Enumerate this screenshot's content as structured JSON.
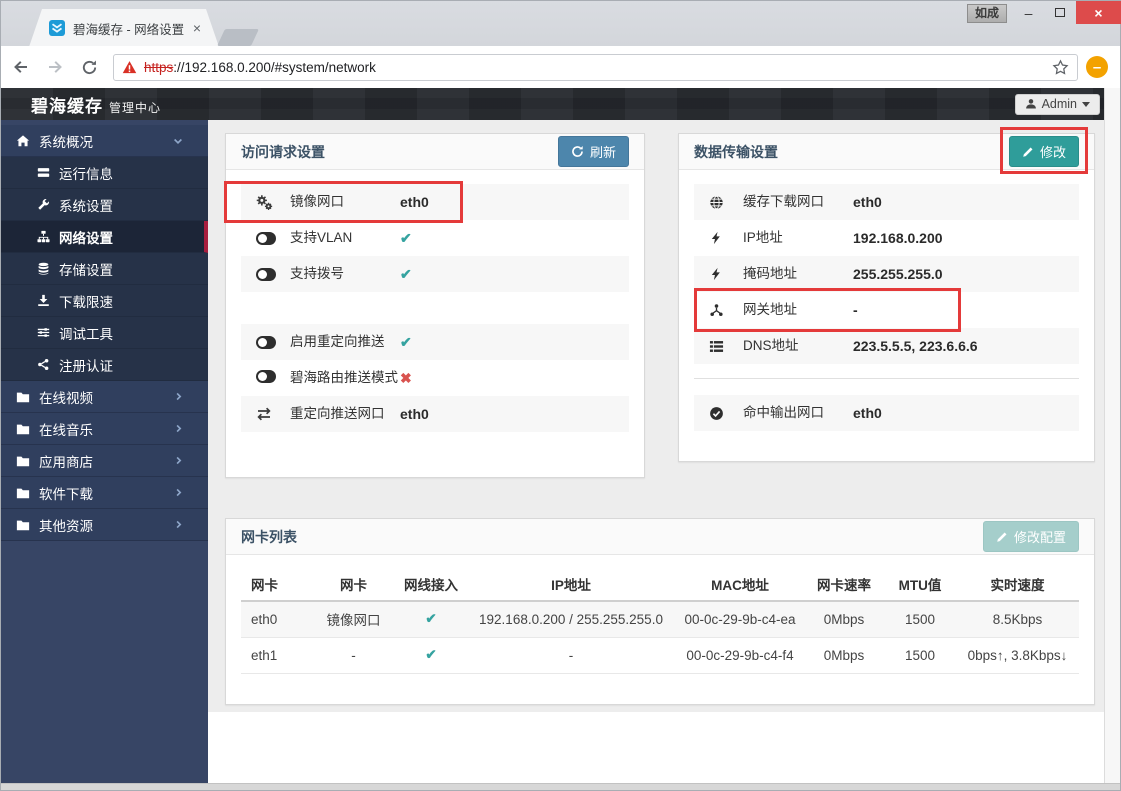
{
  "browser": {
    "tab_title": "碧海缓存 - 网络设置",
    "tab_close": "×",
    "ime_badge": "如成",
    "minimize": "–",
    "close": "×",
    "url_scheme": "https",
    "url_rest": "://192.168.0.200/#system/network",
    "extension_glyph": "–"
  },
  "appbar": {
    "brand": "碧海缓存",
    "brand_sub": "管理中心",
    "user": "Admin"
  },
  "sidebar": {
    "root": "系统概况",
    "submenu": [
      "运行信息",
      "系统设置",
      "网络设置",
      "存储设置",
      "下载限速",
      "调试工具",
      "注册认证"
    ],
    "sections": [
      "在线视频",
      "在线音乐",
      "应用商店",
      "软件下载",
      "其他资源"
    ]
  },
  "access_panel": {
    "title": "访问请求设置",
    "refresh": "刷新",
    "rows": [
      {
        "label": "镜像网口",
        "value": "eth0"
      },
      {
        "label": "支持VLAN",
        "status": "✔"
      },
      {
        "label": "支持拨号",
        "status": "✔"
      },
      {
        "label": "启用重定向推送",
        "status": "✔"
      },
      {
        "label": "碧海路由推送模式",
        "status": "✖"
      },
      {
        "label": "重定向推送网口",
        "value": "eth0"
      }
    ]
  },
  "transfer_panel": {
    "title": "数据传输设置",
    "edit": "修改",
    "rows": [
      {
        "label": "缓存下载网口",
        "value": "eth0"
      },
      {
        "label": "IP地址",
        "value": "192.168.0.200"
      },
      {
        "label": "掩码地址",
        "value": "255.255.255.0"
      },
      {
        "label": "网关地址",
        "value": "-"
      },
      {
        "label": "DNS地址",
        "value": "223.5.5.5, 223.6.6.6"
      },
      {
        "label": "命中输出网口",
        "value": "eth0"
      }
    ]
  },
  "nic_panel": {
    "title": "网卡列表",
    "edit": "修改配置",
    "columns": [
      "网卡",
      "网卡",
      "网线接入",
      "IP地址",
      "MAC地址",
      "网卡速率",
      "MTU值",
      "实时速度"
    ],
    "rows": [
      {
        "name": "eth0",
        "role": "镜像网口",
        "link": "✔",
        "ip": "192.168.0.200 / 255.255.255.0",
        "mac": "00-0c-29-9b-c4-ea",
        "speed": "0Mbps",
        "mtu": "1500",
        "rate": "8.5Kbps"
      },
      {
        "name": "eth1",
        "role": "-",
        "link": "✔",
        "ip": "-",
        "mac": "00-0c-29-9b-c4-f4",
        "speed": "0Mbps",
        "mtu": "1500",
        "rate": "0bps↑, 3.8Kbps↓"
      }
    ]
  },
  "colors": {
    "accent_blue": "#4d86ac",
    "accent_teal": "#2f9d9a",
    "check_teal": "#35a3a0",
    "cross_red": "#d9534f",
    "highlight_red": "#e43a3a",
    "sidebar_active_border": "#a81e3e",
    "close_button_red": "#dd4b4b"
  }
}
